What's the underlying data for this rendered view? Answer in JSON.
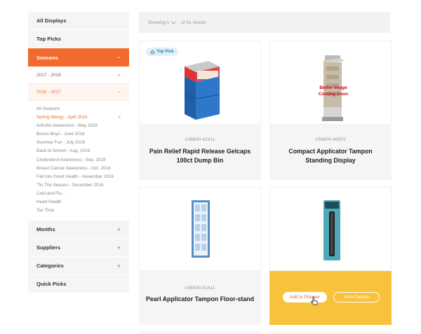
{
  "sidebar": {
    "top_items": [
      "All Displays",
      "Top Picks"
    ],
    "active_section": "Seasons",
    "active_sign": "−",
    "year_collapsed": "2017 - 2018",
    "year_open": "2016 - 2017",
    "plus_sign": "+",
    "minus_sign": "−",
    "seasons": [
      "All Seasons",
      "Spring Allergy - April 2016",
      "Arthritis Awareness - May 2016",
      "Bonus Buys  - June 2016",
      "Summer Fun - July 2016",
      "Back to School - Aug. 2016",
      "Cholesterol Awareness - Sep. 2016",
      "Breast Cancer Awareness - Oct. 2016",
      "Fall Into Good Health - November 2016",
      "'Tis The Season - December 2016",
      "Cold and Flu -",
      "Heart Health",
      "Tax Time"
    ],
    "selected_remove": "×",
    "bottom_items": [
      "Months",
      "Suppliers",
      "Categories",
      "Quick Picks"
    ]
  },
  "results": {
    "prefix": "Showing 1",
    "suffix": "of 61 results"
  },
  "products": [
    {
      "badge": "Top Pick",
      "sku": "#36800-42411",
      "name": "Pain Relief Rapid Release Gelcaps 100ct Dump Bin"
    },
    {
      "sku": "#36800-48501",
      "name": "Compact Applicator Tampon Standing Display",
      "placeholder_text": "Better Image Coming Soon"
    },
    {
      "sku": "#36800-42411",
      "name": "Pearl Applicator Tampon Floor-stand"
    },
    {
      "actions": {
        "add": "Add to Planner",
        "view": "View Details"
      }
    }
  ],
  "colors": {
    "accent": "#f26a2e",
    "hover": "#f9c23c",
    "badge_bg": "#dff1f8"
  }
}
